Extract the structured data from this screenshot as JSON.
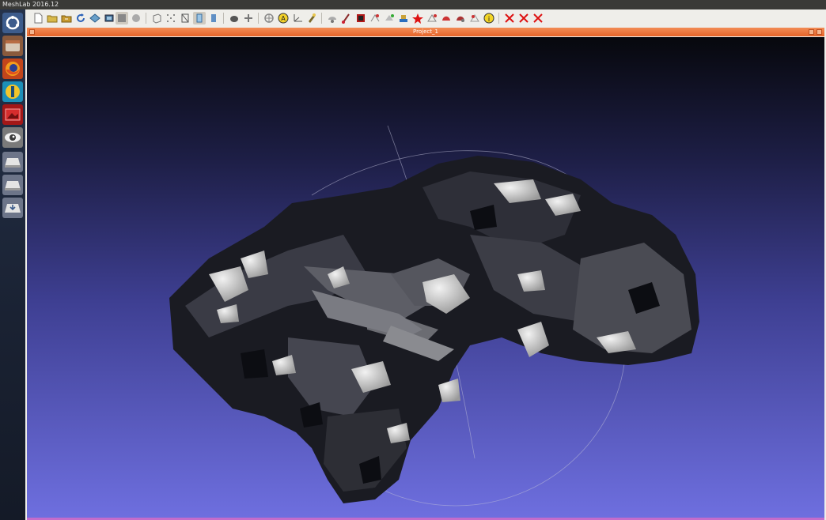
{
  "app": {
    "title": "MeshLab 2016.12"
  },
  "document": {
    "title": "Project_1"
  },
  "colors": {
    "accent": "#e5642a",
    "viewport_top": "#07080d",
    "viewport_bottom": "#6e6fdf"
  },
  "launcher": [
    {
      "icon": "ubuntu-dash-icon"
    },
    {
      "icon": "file-manager-icon"
    },
    {
      "icon": "firefox-icon"
    },
    {
      "icon": "software-center-icon"
    },
    {
      "icon": "image-viewer-icon"
    },
    {
      "icon": "meshlab-eye-icon"
    },
    {
      "icon": "drive-icon"
    },
    {
      "icon": "drive-icon"
    },
    {
      "icon": "usb-drive-icon"
    }
  ],
  "toolbar": [
    {
      "icon": "new-project-icon"
    },
    {
      "icon": "open-project-icon"
    },
    {
      "icon": "open-mesh-icon"
    },
    {
      "icon": "reload-icon"
    },
    {
      "icon": "save-icon"
    },
    {
      "icon": "snapshot-icon"
    },
    {
      "icon": "flat-shading-icon"
    },
    {
      "icon": "smooth-shading-icon"
    },
    {
      "icon": "bounding-box-icon"
    },
    {
      "icon": "points-icon"
    },
    {
      "icon": "wireframe-icon"
    },
    {
      "icon": "hidden-lines-icon"
    },
    {
      "icon": "flat-lines-icon"
    },
    {
      "icon": "lighting-icon"
    },
    {
      "icon": "fancy-lighting-icon"
    },
    {
      "icon": "info-icon"
    },
    {
      "icon": "annotate-icon"
    },
    {
      "icon": "axes-icon"
    },
    {
      "icon": "paint-icon"
    },
    {
      "icon": "select-vertices-icon"
    },
    {
      "icon": "brush-icon"
    },
    {
      "icon": "color-picker-icon"
    },
    {
      "icon": "align-icon"
    },
    {
      "icon": "manipulator-icon"
    },
    {
      "icon": "stamp-icon"
    },
    {
      "icon": "measure-icon"
    },
    {
      "icon": "select-faces-icon"
    },
    {
      "icon": "select-connected-icon"
    },
    {
      "icon": "cut-icon"
    },
    {
      "icon": "georef-icon"
    },
    {
      "icon": "help-info-icon"
    },
    {
      "icon": "delete-vertices-icon"
    },
    {
      "icon": "delete-faces-icon"
    },
    {
      "icon": "delete-all-icon"
    }
  ]
}
